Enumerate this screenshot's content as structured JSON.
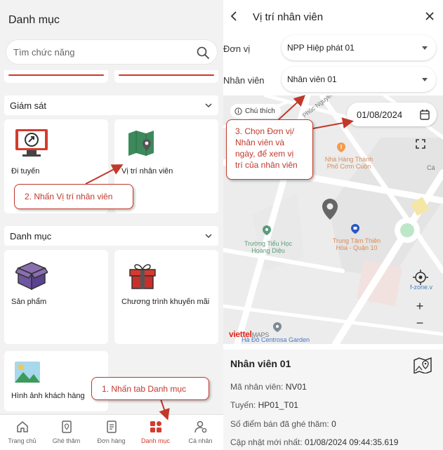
{
  "left": {
    "title": "Danh mục",
    "search_placeholder": "Tìm chức năng",
    "section_monitor": "Giám sát",
    "section_catalog": "Danh mục",
    "monitor_cards": [
      {
        "label": "Đi tuyến",
        "icon": "route-monitor-icon"
      },
      {
        "label": "Vị trí nhân viên",
        "icon": "map-location-icon"
      }
    ],
    "catalog_cards": [
      {
        "label": "Sản phẩm",
        "icon": "product-box-icon"
      },
      {
        "label": "Chương trình khuyến mãi",
        "icon": "gift-icon"
      },
      {
        "label": "Hình ảnh khách hàng",
        "icon": "image-icon"
      }
    ],
    "bottom_nav": [
      {
        "label": "Trang chủ",
        "icon": "home-icon",
        "active": false
      },
      {
        "label": "Ghé thăm",
        "icon": "visit-icon",
        "active": false
      },
      {
        "label": "Đơn hàng",
        "icon": "order-icon",
        "active": false
      },
      {
        "label": "Danh mục",
        "icon": "catalog-icon",
        "active": true
      },
      {
        "label": "Cá nhân",
        "icon": "profile-settings-icon",
        "active": false
      }
    ]
  },
  "right": {
    "title": "Vị trí nhân viên",
    "unit_label": "Đơn vị",
    "unit_value": "NPP Hiệp phát 01",
    "staff_label": "Nhân viên",
    "staff_value": "Nhân viên 01",
    "legend_label": "Chú thích",
    "date_value": "01/08/2024",
    "map_labels": {
      "street": "Phúc Nguyên",
      "restaurant_1": "Nhà Hàng Thành",
      "restaurant_2": "Phố Cơm Cuộn",
      "school_1": "Trường Tiểu Học",
      "school_2": "Hoàng Diệu",
      "mall_1": "Trung Tâm Thiên",
      "mall_2": "Hòa - Quận 10",
      "garden": "Hà Đô Centrosa Garden",
      "fzone": "f-zone.v",
      "ca": "Cá"
    },
    "brand": "viettel",
    "brand_suffix": "MAPS",
    "zoom_in": "+",
    "zoom_out": "−",
    "info": {
      "name": "Nhân viên 01",
      "code_label": "Mã nhân viên:",
      "code": "NV01",
      "route_label": "Tuyến:",
      "route": "HP01_T01",
      "visited_label": "Số điểm bán đã ghé thăm:",
      "visited": "0",
      "updated_label": "Cập nhật mới nhất:",
      "updated": "01/08/2024 09:44:35.619"
    }
  },
  "callouts": {
    "step1": "1. Nhấn tab Danh mục",
    "step2": "2. Nhấn Vị trí nhân viên",
    "step3_l1": "3. Chọn Đơn vị/",
    "step3_l2": "Nhân viên và",
    "step3_l3": "ngày, để xem vị",
    "step3_l4": "trí của nhân viên"
  },
  "colors": {
    "accent_red": "#d23b2d",
    "callout_red": "#c0392b",
    "icon_green": "#3c8a5c"
  }
}
